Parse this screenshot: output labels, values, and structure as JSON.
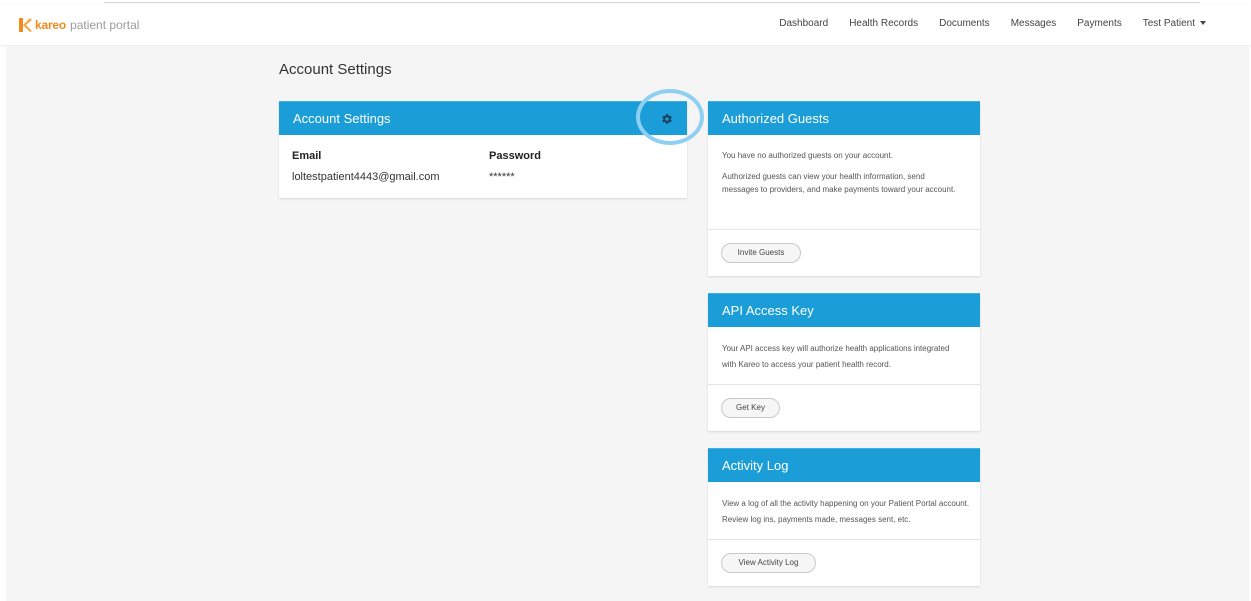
{
  "header": {
    "brand": "kareo",
    "product": "patient portal",
    "nav": [
      "Dashboard",
      "Health Records",
      "Documents",
      "Messages",
      "Payments"
    ],
    "user_menu": "Test Patient"
  },
  "page": {
    "title": "Account Settings"
  },
  "account_card": {
    "title": "Account Settings",
    "email_label": "Email",
    "email_value": "loltestpatient4443@gmail.com",
    "password_label": "Password",
    "password_value": "******"
  },
  "guests_card": {
    "title": "Authorized Guests",
    "text1": "You have no authorized guests on your account.",
    "text2": "Authorized guests can view your health information, send messages to providers, and make payments toward your account.",
    "button": "Invite Guests"
  },
  "api_card": {
    "title": "API Access Key",
    "text": "Your API access key will authorize health applications integrated with Kareo to access your patient health record.",
    "button": "Get Key"
  },
  "activity_card": {
    "title": "Activity Log",
    "text": "View a log of all the activity happening on your Patient Portal account. Review log ins, payments made, messages sent, etc.",
    "button": "View Activity Log"
  },
  "colors": {
    "header_blue": "#1b9ed8",
    "brand_orange": "#f18a1f",
    "annotation_circle": "#8fd0f2"
  },
  "icons": {
    "settings": "gear-icon",
    "menu": "caret-down-icon",
    "logo": "kareo-logo"
  }
}
